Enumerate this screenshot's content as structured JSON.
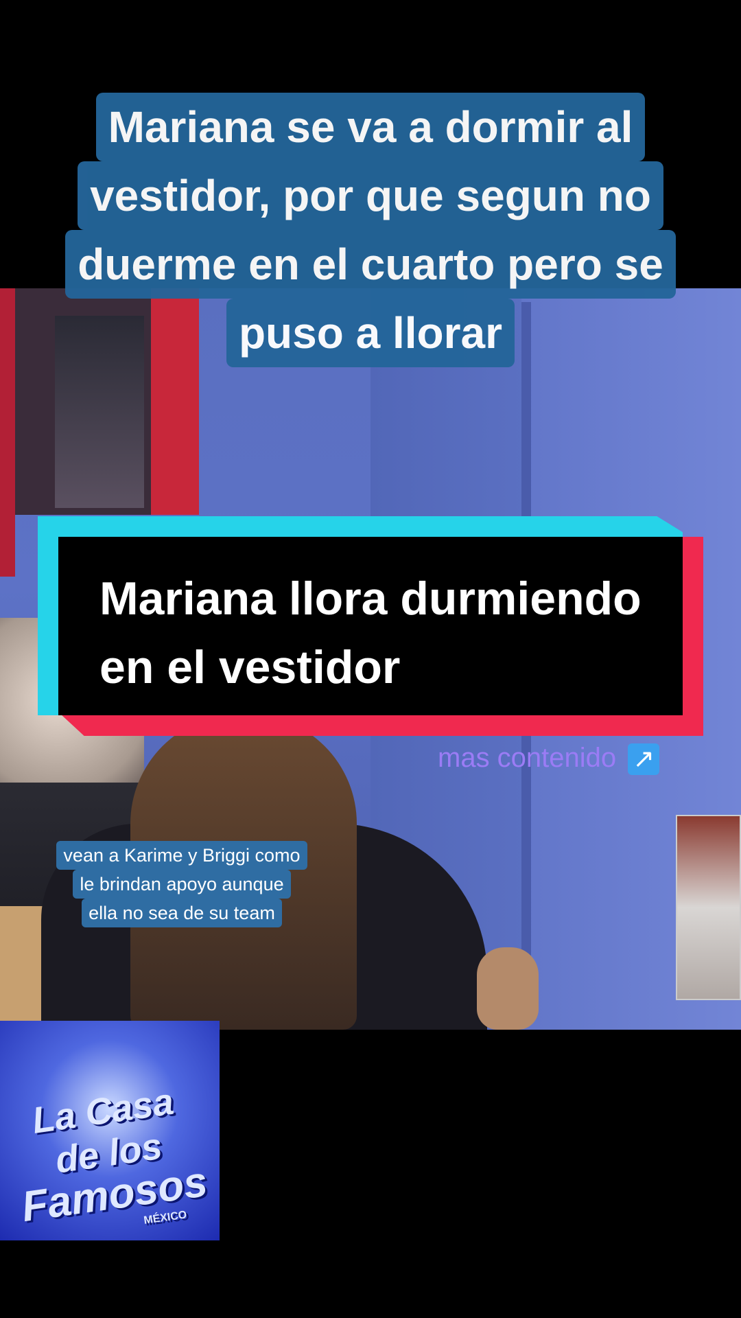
{
  "top_caption": {
    "lines": [
      "Mariana se va a dormir al",
      "vestidor, por que segun no",
      "duerme en el cuarto pero se",
      "puso a llorar"
    ]
  },
  "title_card": {
    "line1": "Mariana llora durmiendo",
    "line2": "en el vestidor"
  },
  "more_link": {
    "label": "mas contenido",
    "icon": "↗"
  },
  "sub_caption": {
    "lines": [
      "vean a Karime y Briggi como",
      "le brindan apoyo aunque",
      "ella no sea de su team"
    ]
  },
  "logo": {
    "line1": "La Casa de los",
    "line2": "Famosos",
    "line3": "MÉXICO"
  },
  "colors": {
    "caption_bg": "#24659a",
    "card_cyan": "#26d3e9",
    "card_red": "#f0294f",
    "more_text": "#9b7cf5"
  }
}
